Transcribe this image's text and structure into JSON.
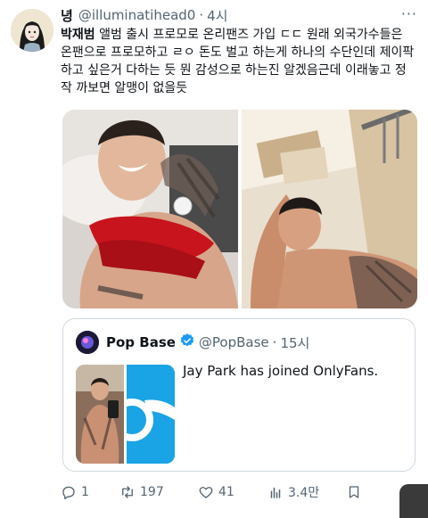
{
  "tweet": {
    "author_name": "녕",
    "author_handle": "@illuminatihead0",
    "separator": "·",
    "time": "4시",
    "more_label": "···",
    "text_bold": "박재범",
    "text_rest": " 앨범 출시 프로모로 온리팬즈 가입 ㄷㄷ 원래 외국가수들은 온팬으로 프로모하고 ㄹㅇ 돈도 벌고 하는게 하나의 수단인데 제이팍 하고 싶은거 다하는 듯 뭔 감성으로 하는진 알겠음근데 이래놓고 정작 까보면 알맹이 없을듯"
  },
  "quote": {
    "name": "Pop Base",
    "handle": "@PopBase",
    "separator": "·",
    "time": "15시",
    "text": "Jay Park has joined OnlyFans."
  },
  "actions": {
    "replies": "1",
    "retweets": "197",
    "likes": "41",
    "views": "3.4만"
  },
  "colors": {
    "verified": "#1d9bf0",
    "muted_text": "#536471",
    "onlyfans_blue": "#1aa3e5"
  }
}
